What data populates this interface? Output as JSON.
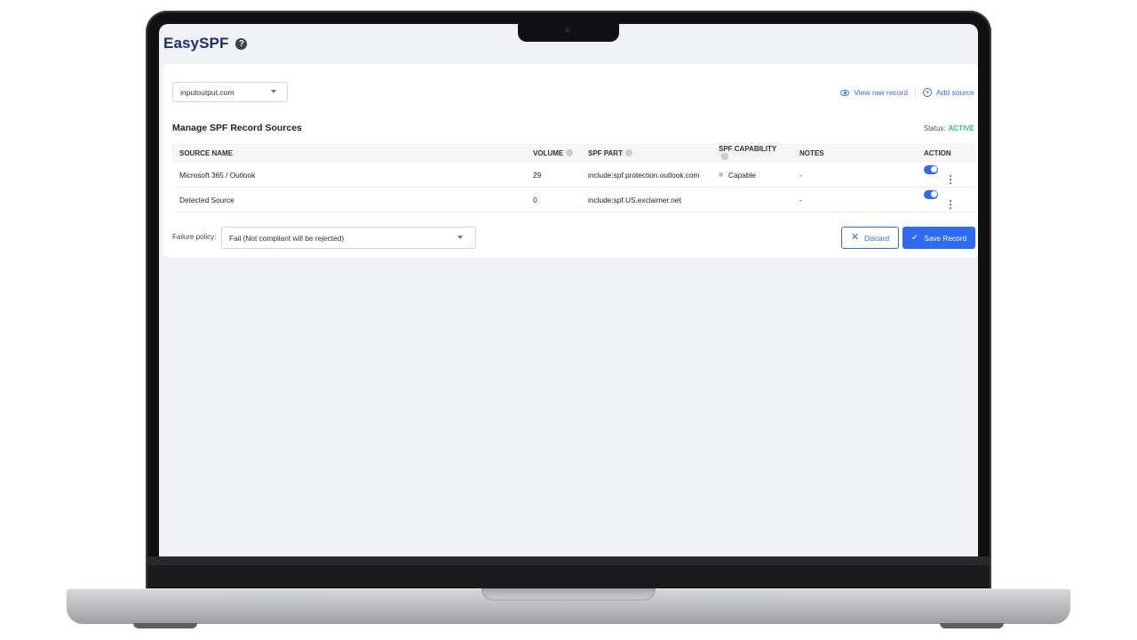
{
  "app": {
    "title": "EasySPF",
    "help_glyph": "?"
  },
  "domain_select": {
    "value": "inputoutput.com"
  },
  "actions": {
    "view_raw": "View raw record",
    "add_source": "Add source"
  },
  "section": {
    "title": "Manage SPF Record Sources",
    "status_label": "Status:",
    "status_value": "ACTIVE"
  },
  "table": {
    "headers": {
      "source_name": "SOURCE NAME",
      "volume": "VOLUME",
      "spf_part": "SPF PART",
      "spf_capability": "SPF CAPABILITY",
      "notes": "NOTES",
      "action": "ACTION"
    },
    "rows": [
      {
        "source_name": "Microsoft 365 / Outlook",
        "volume": "29",
        "spf_part": "include:spf.protection.outlook.com",
        "capability": "Capable",
        "notes": "-",
        "enabled": true
      },
      {
        "source_name": "Detected Source",
        "volume": "0",
        "spf_part": "include:spf.US.exclaimer.net",
        "capability": "",
        "notes": "-",
        "enabled": true
      }
    ]
  },
  "policy": {
    "label": "Failure policy:",
    "value": "Fail (Not compliant will be rejected)"
  },
  "buttons": {
    "discard": "Discard",
    "save": "Save Record"
  },
  "colors": {
    "accent": "#2f6bf0",
    "title": "#1d2f6f",
    "active": "#2fbf71"
  }
}
